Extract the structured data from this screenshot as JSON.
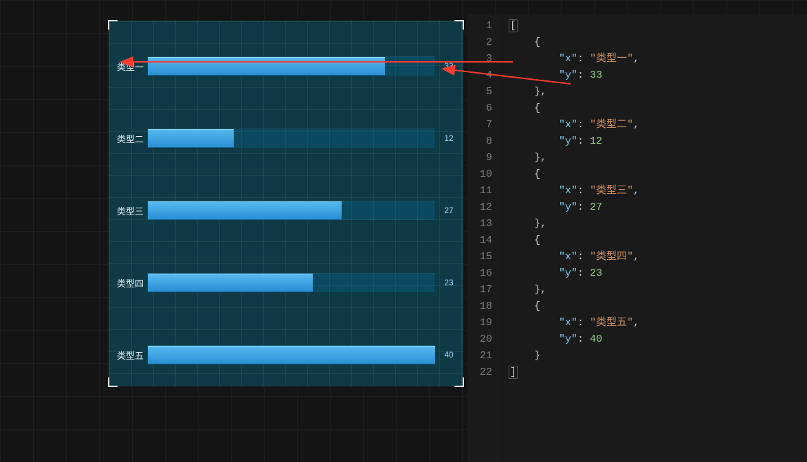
{
  "chart_data": {
    "type": "bar",
    "orientation": "horizontal",
    "categories": [
      "类型一",
      "类型二",
      "类型三",
      "类型四",
      "类型五"
    ],
    "values": [
      33,
      12,
      27,
      23,
      40
    ],
    "xlim": [
      0,
      40
    ],
    "background": "#0e3a46",
    "bar_color": "#2a8fd4"
  },
  "bars": [
    {
      "label": "类型一",
      "value": 33
    },
    {
      "label": "类型二",
      "value": 12
    },
    {
      "label": "类型三",
      "value": 27
    },
    {
      "label": "类型四",
      "value": 23
    },
    {
      "label": "类型五",
      "value": 40
    }
  ],
  "editor": {
    "lines": [
      {
        "n": 1,
        "tokens": [
          {
            "t": "[",
            "c": "brace",
            "match": true
          }
        ]
      },
      {
        "n": 2,
        "tokens": [
          {
            "t": "    {",
            "c": "brace"
          }
        ]
      },
      {
        "n": 3,
        "tokens": [
          {
            "t": "        "
          },
          {
            "t": "\"x\"",
            "c": "key"
          },
          {
            "t": ": "
          },
          {
            "t": "\"类型一\"",
            "c": "str"
          },
          {
            "t": ",",
            "c": "punc"
          }
        ]
      },
      {
        "n": 4,
        "tokens": [
          {
            "t": "        "
          },
          {
            "t": "\"y\"",
            "c": "key"
          },
          {
            "t": ": "
          },
          {
            "t": "33",
            "c": "num"
          }
        ]
      },
      {
        "n": 5,
        "tokens": [
          {
            "t": "    },",
            "c": "brace"
          }
        ]
      },
      {
        "n": 6,
        "tokens": [
          {
            "t": "    {",
            "c": "brace"
          }
        ]
      },
      {
        "n": 7,
        "tokens": [
          {
            "t": "        "
          },
          {
            "t": "\"x\"",
            "c": "key"
          },
          {
            "t": ": "
          },
          {
            "t": "\"类型二\"",
            "c": "str"
          },
          {
            "t": ",",
            "c": "punc"
          }
        ]
      },
      {
        "n": 8,
        "tokens": [
          {
            "t": "        "
          },
          {
            "t": "\"y\"",
            "c": "key"
          },
          {
            "t": ": "
          },
          {
            "t": "12",
            "c": "num"
          }
        ]
      },
      {
        "n": 9,
        "tokens": [
          {
            "t": "    },",
            "c": "brace"
          }
        ]
      },
      {
        "n": 10,
        "tokens": [
          {
            "t": "    {",
            "c": "brace"
          }
        ]
      },
      {
        "n": 11,
        "tokens": [
          {
            "t": "        "
          },
          {
            "t": "\"x\"",
            "c": "key"
          },
          {
            "t": ": "
          },
          {
            "t": "\"类型三\"",
            "c": "str"
          },
          {
            "t": ",",
            "c": "punc"
          }
        ]
      },
      {
        "n": 12,
        "tokens": [
          {
            "t": "        "
          },
          {
            "t": "\"y\"",
            "c": "key"
          },
          {
            "t": ": "
          },
          {
            "t": "27",
            "c": "num"
          }
        ]
      },
      {
        "n": 13,
        "tokens": [
          {
            "t": "    },",
            "c": "brace"
          }
        ]
      },
      {
        "n": 14,
        "tokens": [
          {
            "t": "    {",
            "c": "brace"
          }
        ]
      },
      {
        "n": 15,
        "tokens": [
          {
            "t": "        "
          },
          {
            "t": "\"x\"",
            "c": "key"
          },
          {
            "t": ": "
          },
          {
            "t": "\"类型四\"",
            "c": "str"
          },
          {
            "t": ",",
            "c": "punc"
          }
        ]
      },
      {
        "n": 16,
        "tokens": [
          {
            "t": "        "
          },
          {
            "t": "\"y\"",
            "c": "key"
          },
          {
            "t": ": "
          },
          {
            "t": "23",
            "c": "num"
          }
        ]
      },
      {
        "n": 17,
        "tokens": [
          {
            "t": "    },",
            "c": "brace"
          }
        ]
      },
      {
        "n": 18,
        "tokens": [
          {
            "t": "    {",
            "c": "brace"
          }
        ]
      },
      {
        "n": 19,
        "tokens": [
          {
            "t": "        "
          },
          {
            "t": "\"x\"",
            "c": "key"
          },
          {
            "t": ": "
          },
          {
            "t": "\"类型五\"",
            "c": "str"
          },
          {
            "t": ",",
            "c": "punc"
          }
        ]
      },
      {
        "n": 20,
        "tokens": [
          {
            "t": "        "
          },
          {
            "t": "\"y\"",
            "c": "key"
          },
          {
            "t": ": "
          },
          {
            "t": "40",
            "c": "num"
          }
        ]
      },
      {
        "n": 21,
        "tokens": [
          {
            "t": "    }",
            "c": "brace"
          }
        ]
      },
      {
        "n": 22,
        "tokens": [
          {
            "t": "]",
            "c": "brace",
            "match": true
          }
        ]
      }
    ]
  },
  "arrows": [
    {
      "from": [
        746,
        90
      ],
      "to": [
        176,
        90
      ]
    },
    {
      "from": [
        830,
        122
      ],
      "to": [
        644,
        100
      ]
    }
  ],
  "arrow_color": "#ff3b2f"
}
